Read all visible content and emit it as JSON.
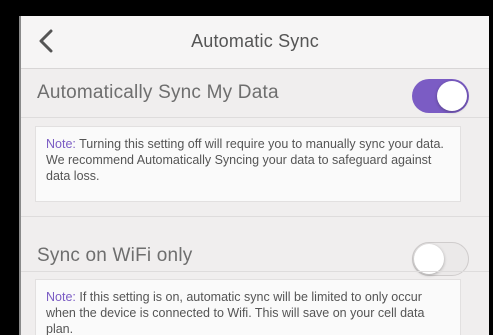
{
  "header": {
    "title": "Automatic Sync",
    "back_icon": "chevron-left-icon"
  },
  "settings": [
    {
      "label": "Automatically Sync My Data",
      "enabled": true,
      "note_prefix": "Note:",
      "note_text": " Turning this setting off will require you to manually sync your data. We recommend Automatically Syncing your data to safeguard against data loss."
    },
    {
      "label": "Sync on WiFi only",
      "enabled": false,
      "note_prefix": "Note:",
      "note_text": " If this setting is on, automatic sync will be limited to only occur when the device is connected to Wifi. This will save on your cell data plan."
    }
  ],
  "colors": {
    "accent": "#7b5cc4",
    "background": "#f0eeee",
    "text": "#6e6e6e"
  }
}
